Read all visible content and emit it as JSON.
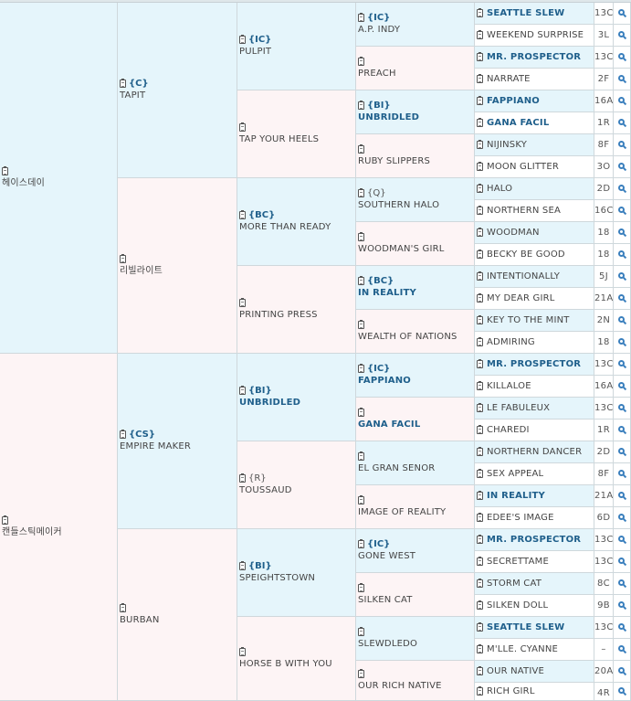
{
  "pedigree": {
    "sire": {
      "name": "헤이스데이",
      "code": "",
      "sire": {
        "name": "TAPIT",
        "code": "{C}",
        "sire": {
          "name": "PULPIT",
          "code": "{IC}",
          "sire": {
            "name": "A.P. INDY",
            "code": "{IC}",
            "sire": {
              "name": "SEATTLE SLEW",
              "bold": true,
              "rec": "13C"
            },
            "dam": {
              "name": "WEEKEND SURPRISE",
              "rec": "3L"
            }
          },
          "dam": {
            "name": "PREACH",
            "code": "",
            "sire": {
              "name": "MR. PROSPECTOR",
              "bold": true,
              "rec": "13C"
            },
            "dam": {
              "name": "NARRATE",
              "rec": "2F"
            }
          }
        },
        "dam": {
          "name": "TAP YOUR HEELS",
          "code": "",
          "sire": {
            "name": "UNBRIDLED",
            "code": "{BI}",
            "bold": true,
            "sire": {
              "name": "FAPPIANO",
              "bold": true,
              "rec": "16A"
            },
            "dam": {
              "name": "GANA FACIL",
              "bold": true,
              "rec": "1R"
            }
          },
          "dam": {
            "name": "RUBY SLIPPERS",
            "code": "",
            "sire": {
              "name": "NIJINSKY",
              "rec": "8F"
            },
            "dam": {
              "name": "MOON GLITTER",
              "rec": "3O"
            }
          }
        }
      },
      "dam": {
        "name": "리빌라이트",
        "code": "",
        "sire": {
          "name": "MORE THAN READY",
          "code": "{BC}",
          "sire": {
            "name": "SOUTHERN HALO",
            "code": "{Q}",
            "codePlain": true,
            "sire": {
              "name": "HALO",
              "rec": "2D"
            },
            "dam": {
              "name": "NORTHERN SEA",
              "rec": "16C"
            }
          },
          "dam": {
            "name": "WOODMAN'S GIRL",
            "code": "",
            "sire": {
              "name": "WOODMAN",
              "rec": "18"
            },
            "dam": {
              "name": "BECKY BE GOOD",
              "rec": "18"
            }
          }
        },
        "dam": {
          "name": "PRINTING PRESS",
          "code": "",
          "sire": {
            "name": "IN REALITY",
            "code": "{BC}",
            "bold": true,
            "sire": {
              "name": "INTENTIONALLY",
              "rec": "5J"
            },
            "dam": {
              "name": "MY DEAR GIRL",
              "rec": "21A"
            }
          },
          "dam": {
            "name": "WEALTH OF NATIONS",
            "code": "",
            "sire": {
              "name": "KEY TO THE MINT",
              "rec": "2N"
            },
            "dam": {
              "name": "ADMIRING",
              "rec": "18"
            }
          }
        }
      }
    },
    "dam": {
      "name": "캔들스틱메이커",
      "code": "",
      "sire": {
        "name": "EMPIRE MAKER",
        "code": "{CS}",
        "sire": {
          "name": "UNBRIDLED",
          "code": "{BI}",
          "bold": true,
          "sire": {
            "name": "FAPPIANO",
            "code": "{IC}",
            "bold": true,
            "sire": {
              "name": "MR. PROSPECTOR",
              "bold": true,
              "rec": "13C"
            },
            "dam": {
              "name": "KILLALOE",
              "rec": "16A"
            }
          },
          "dam": {
            "name": "GANA FACIL",
            "code": "",
            "bold": true,
            "sire": {
              "name": "LE FABULEUX",
              "rec": "13C"
            },
            "dam": {
              "name": "CHAREDI",
              "rec": "1R"
            }
          }
        },
        "dam": {
          "name": "TOUSSAUD",
          "code": "{R}",
          "codePlain": true,
          "sire": {
            "name": "EL GRAN SENOR",
            "code": "",
            "sire": {
              "name": "NORTHERN DANCER",
              "rec": "2D"
            },
            "dam": {
              "name": "SEX APPEAL",
              "rec": "8F"
            }
          },
          "dam": {
            "name": "IMAGE OF REALITY",
            "code": "",
            "sire": {
              "name": "IN REALITY",
              "bold": true,
              "rec": "21A"
            },
            "dam": {
              "name": "EDEE'S IMAGE",
              "rec": "6D"
            }
          }
        }
      },
      "dam": {
        "name": "BURBAN",
        "code": "",
        "sire": {
          "name": "SPEIGHTSTOWN",
          "code": "{BI}",
          "sire": {
            "name": "GONE WEST",
            "code": "{IC}",
            "sire": {
              "name": "MR. PROSPECTOR",
              "bold": true,
              "rec": "13C"
            },
            "dam": {
              "name": "SECRETTAME",
              "rec": "13C"
            }
          },
          "dam": {
            "name": "SILKEN CAT",
            "code": "",
            "sire": {
              "name": "STORM CAT",
              "rec": "8C"
            },
            "dam": {
              "name": "SILKEN DOLL",
              "rec": "9B"
            }
          }
        },
        "dam": {
          "name": "HORSE B WITH YOU",
          "code": "",
          "sire": {
            "name": "SLEWDLEDO",
            "code": "",
            "sire": {
              "name": "SEATTLE SLEW",
              "bold": true,
              "rec": "13C"
            },
            "dam": {
              "name": "M'LLE. CYANNE",
              "rec": "–"
            }
          },
          "dam": {
            "name": "OUR RICH NATIVE",
            "code": "",
            "sire": {
              "name": "OUR NATIVE",
              "rec": "20A"
            },
            "dam": {
              "name": "RICH GIRL",
              "rec": "4R"
            }
          }
        }
      }
    }
  },
  "colors": {
    "sire_bg": "#e5f5fb",
    "dam_bg": "#fdf4f5",
    "link": "#1f5f8b",
    "search_icon": "#3a7fbd"
  },
  "icons": {
    "record": "clipboard-icon",
    "action": "search-icon"
  }
}
